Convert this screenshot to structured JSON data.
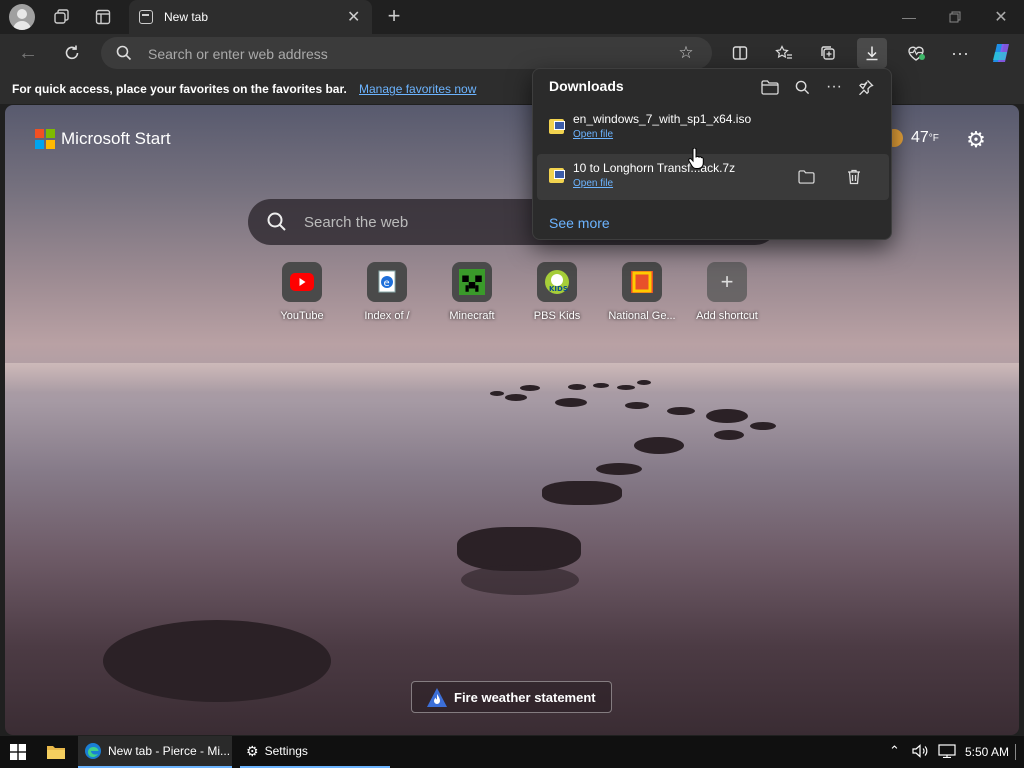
{
  "browser": {
    "tab_title": "New tab",
    "address_placeholder": "Search or enter web address"
  },
  "favorites_bar": {
    "message": "For quick access, place your favorites on the favorites bar.",
    "link": "Manage favorites now"
  },
  "newtab": {
    "brand": "Microsoft Start",
    "temperature": "47",
    "temp_unit": "°F",
    "search_placeholder": "Search the web",
    "shortcuts": [
      {
        "label": "YouTube"
      },
      {
        "label": "Index of /"
      },
      {
        "label": "Minecraft"
      },
      {
        "label": "PBS Kids"
      },
      {
        "label": "National Ge..."
      },
      {
        "label": "Add shortcut"
      }
    ],
    "alert": "Fire weather statement"
  },
  "downloads": {
    "title": "Downloads",
    "items": [
      {
        "name": "en_windows_7_with_sp1_x64.iso",
        "action": "Open file"
      },
      {
        "name": "10 to Longhorn Transf...ack.7z",
        "action": "Open file"
      }
    ],
    "see_more": "See more"
  },
  "taskbar": {
    "items": [
      {
        "label": "New tab - Pierce - Mi..."
      },
      {
        "label": "Settings"
      }
    ],
    "clock": "5:50 AM"
  },
  "colors": {
    "link": "#6cb4ff",
    "ms_red": "#f25022",
    "ms_green": "#7fba00",
    "ms_blue": "#00a4ef",
    "ms_yellow": "#ffb900",
    "youtube": "#ff0000"
  }
}
